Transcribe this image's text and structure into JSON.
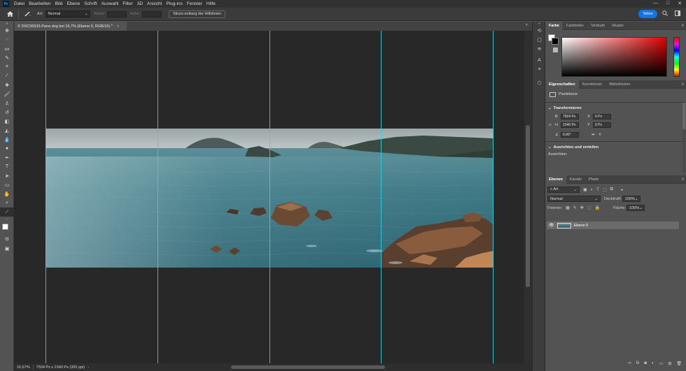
{
  "app": {
    "logo": "Ps"
  },
  "menu": [
    "Datei",
    "Bearbeiten",
    "Bild",
    "Ebene",
    "Schrift",
    "Auswahl",
    "Filter",
    "3D",
    "Ansicht",
    "Plug-ins",
    "Fenster",
    "Hilfe"
  ],
  "window_controls": {
    "minimize": "—",
    "maximize": "□",
    "close": "✕"
  },
  "options": {
    "style_label": "Art:",
    "style_value": "Normal",
    "width_label": "Breite:",
    "height_label": "Höhe:",
    "slices_button": "Slices entlang der Hilfslinien",
    "share_button": "Teilen"
  },
  "document": {
    "tab_title": "© DSC05533-Pano.dng bei 16,7% (Ebene 0, RGB/16) *",
    "tab_close": "×"
  },
  "status": {
    "zoom": "16,67%",
    "info": "7504 Px x 2340 Px (300 ppi)"
  },
  "color_panel": {
    "tabs": [
      "Farbe",
      "Farbfelder",
      "Verläufe",
      "Muster"
    ],
    "active_tab": 0,
    "foreground": "#ffffff",
    "background": "#000000",
    "hue_color": "#e00000"
  },
  "properties_panel": {
    "tabs": [
      "Eigenschaften",
      "Korrekturen",
      "Bibliotheken"
    ],
    "layer_type": "Pixelebene",
    "transform_title": "Transformieren",
    "b_label": "B",
    "b_value": "7504 Px",
    "h_label": "H",
    "h_value": "2340 Px",
    "x_label": "X",
    "x_value": "0 Px",
    "y_label": "Y",
    "y_value": "0 Px",
    "angle_value": "0,00°",
    "align_title": "Ausrichten und verteilen",
    "align_label": "Ausrichten:"
  },
  "layers_panel": {
    "tabs": [
      "Ebenen",
      "Kanäle",
      "Pfade"
    ],
    "filter_value": "Art",
    "blend_mode": "Normal",
    "opacity_label": "Deckkraft:",
    "opacity_value": "100%",
    "lock_label": "Fixieren:",
    "fill_label": "Fläche:",
    "fill_value": "100%",
    "layers": [
      {
        "name": "Ebene 0",
        "visible": true
      }
    ]
  },
  "colors": {
    "accent": "#1473e6",
    "guide": "#28d8e8"
  }
}
